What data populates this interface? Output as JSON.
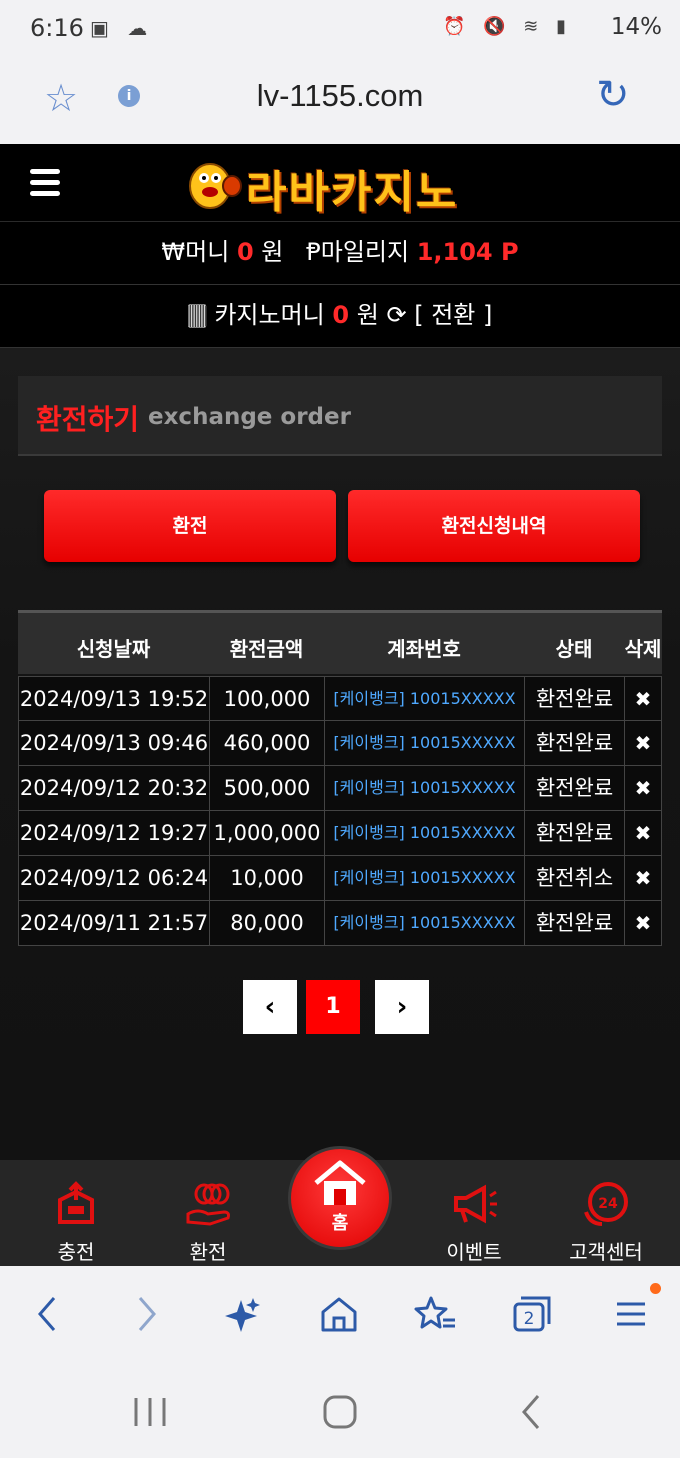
{
  "status_bar": {
    "time": "6:16",
    "battery": "14%"
  },
  "browser": {
    "url": "lv-1155.com"
  },
  "header": {
    "logo_text": "라바카지노"
  },
  "wallet": {
    "money_label": "₩머니",
    "money_value": "0",
    "money_unit": "원",
    "mileage_label": "Ᵽ마일리지",
    "mileage_value": "1,104 P",
    "casino_label": "카지노머니",
    "casino_value": "0",
    "casino_unit": "원",
    "convert_label": "[ 전환 ]"
  },
  "page": {
    "title_kr": "환전하기",
    "title_en": "exchange order",
    "btn_exchange": "환전",
    "btn_history": "환전신청내역"
  },
  "table": {
    "headers": [
      "신청날짜",
      "환전금액",
      "계좌번호",
      "상태",
      "삭제"
    ],
    "rows": [
      {
        "date": "2024/09/13 19:52",
        "amount": "100,000",
        "account": "[케이뱅크] 10015XXXXX",
        "status": "환전완료",
        "delete": "✖"
      },
      {
        "date": "2024/09/13 09:46",
        "amount": "460,000",
        "account": "[케이뱅크] 10015XXXXX",
        "status": "환전완료",
        "delete": "✖"
      },
      {
        "date": "2024/09/12 20:32",
        "amount": "500,000",
        "account": "[케이뱅크] 10015XXXXX",
        "status": "환전완료",
        "delete": "✖"
      },
      {
        "date": "2024/09/12 19:27",
        "amount": "1,000,000",
        "account": "[케이뱅크] 10015XXXXX",
        "status": "환전완료",
        "delete": "✖"
      },
      {
        "date": "2024/09/12 06:24",
        "amount": "10,000",
        "account": "[케이뱅크] 10015XXXXX",
        "status": "환전취소",
        "delete": "✖"
      },
      {
        "date": "2024/09/11 21:57",
        "amount": "80,000",
        "account": "[케이뱅크] 10015XXXXX",
        "status": "환전완료",
        "delete": "✖"
      }
    ]
  },
  "pagination": {
    "prev": "‹",
    "current": "1",
    "next": "›"
  },
  "site_nav": {
    "charge": "충전",
    "exchange": "환전",
    "home": "홈",
    "event": "이벤트",
    "support": "고객센터"
  },
  "browser_toolbar": {
    "tab_count": "2"
  },
  "colors": {
    "accent_red": "#ff0000",
    "link_blue": "#4fa9ff",
    "browser_blue": "#2d5aa8"
  }
}
